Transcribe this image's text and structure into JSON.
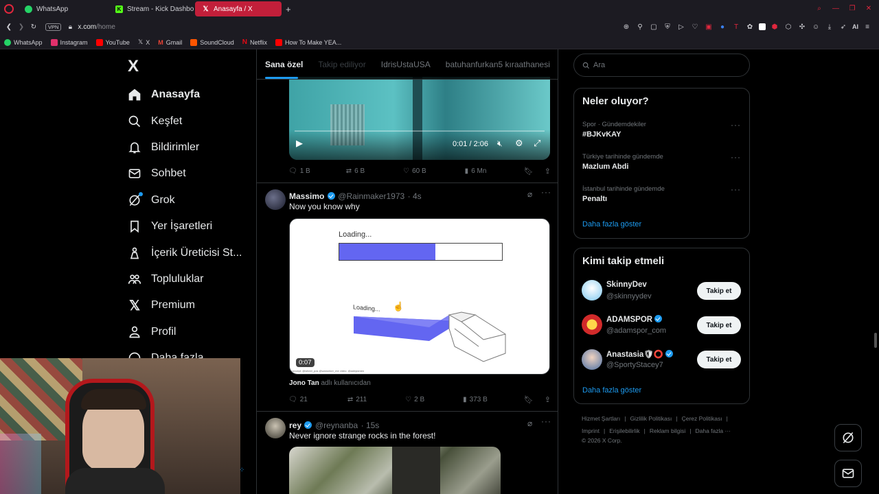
{
  "browser": {
    "tabs": [
      {
        "label": "WhatsApp",
        "color": "#25d366",
        "active": false
      },
      {
        "label": "Stream - Kick Dashboard",
        "color": "#53fc18",
        "active": false
      },
      {
        "label": "Anasayfa / X",
        "color": "#000000",
        "active": true
      }
    ],
    "new_tab": "+",
    "vpn_badge": "VPN",
    "url_host": "x.com",
    "url_path": "/home",
    "ai_label": "AI",
    "bookmarks": [
      {
        "label": "WhatsApp",
        "color": "#25d366"
      },
      {
        "label": "Instagram",
        "color": "#e1306c"
      },
      {
        "label": "YouTube",
        "color": "#ff0000"
      },
      {
        "label": "X",
        "color": "#ffffff"
      },
      {
        "label": "Gmail",
        "color": "#ea4335"
      },
      {
        "label": "SoundCloud",
        "color": "#ff5500"
      },
      {
        "label": "Netflix",
        "color": "#e50914"
      },
      {
        "label": "How To Make YEA...",
        "color": "#ff0000"
      }
    ]
  },
  "nav": {
    "logo": "X",
    "items": [
      {
        "label": "Anasayfa",
        "icon": "home-icon"
      },
      {
        "label": "Keşfet",
        "icon": "search-icon"
      },
      {
        "label": "Bildirimler",
        "icon": "bell-icon"
      },
      {
        "label": "Sohbet",
        "icon": "mail-icon"
      },
      {
        "label": "Grok",
        "icon": "grok-icon"
      },
      {
        "label": "Yer İşaretleri",
        "icon": "bookmark-icon"
      },
      {
        "label": "İçerik Üreticisi St...",
        "icon": "creator-icon"
      },
      {
        "label": "Topluluklar",
        "icon": "communities-icon"
      },
      {
        "label": "Premium",
        "icon": "x-icon"
      },
      {
        "label": "Profil",
        "icon": "profile-icon"
      },
      {
        "label": "Daha fazla",
        "icon": "more-icon"
      }
    ]
  },
  "feed": {
    "tabs": [
      "Sana özel",
      "Takip ediliyor",
      "IdrisUstaUSA",
      "batuhanfurkan5 kıraathanesi"
    ],
    "tweet1": {
      "video_time": "0:01 / 2:06",
      "replies": "1 B",
      "reposts": "6 B",
      "likes": "60 B",
      "views": "6 Mn"
    },
    "tweet2": {
      "name": "Massimo",
      "handle": "@Rainmaker1973",
      "time": "· 4s",
      "text": "Now you know why",
      "media_loading_top": "Loading...",
      "media_loading_bottom": "Loading...",
      "media_progress": 0.59,
      "media_credit": "concept: @wheel_pos @wanonker_me video: @addyiamen",
      "video_duration": "0:07",
      "attribution_name": "Jono Tan",
      "attribution_rest": "adlı kullanıcıdan",
      "replies": "21",
      "reposts": "211",
      "likes": "2 B",
      "views": "373 B"
    },
    "tweet3": {
      "name": "rey",
      "handle": "@reynanba",
      "time": "· 15s",
      "text": "Never ignore strange rocks in the forest!"
    }
  },
  "right": {
    "search_placeholder": "Ara",
    "trends_title": "Neler oluyor?",
    "trends": [
      {
        "meta": "Spor · Gündemdekiler",
        "name": "#BJKvKAY"
      },
      {
        "meta": "Türkiye tarihinde gündemde",
        "name": "Mazlum Abdi"
      },
      {
        "meta": "İstanbul tarihinde gündemde",
        "name": "Penaltı"
      }
    ],
    "trends_more": "Daha fazla göster",
    "wtf_title": "Kimi takip etmeli",
    "who_to_follow": [
      {
        "name": "SkinnyDev",
        "handle": "@skinnyydev",
        "button": "Takip et"
      },
      {
        "name": "ADAMSPOR",
        "handle": "@adamspor_com",
        "button": "Takip et"
      },
      {
        "name": "Anastasia🛡⭕",
        "handle": "@SportyStacey7",
        "button": "Takip et"
      }
    ],
    "wtf_more": "Daha fazla göster",
    "footer_row1": [
      "Hizmet Şartları",
      "Gizlilik Politikası",
      "Çerez Politikası"
    ],
    "footer_row2": [
      "Imprint",
      "Erişilebilirlik",
      "Reklam bilgisi",
      "Daha fazla ···"
    ],
    "copyright": "© 2026 X Corp."
  },
  "colors": {
    "accent": "#1d9bf0",
    "active_tab": "#c21f3a",
    "progress_fill": "#6366f1"
  }
}
